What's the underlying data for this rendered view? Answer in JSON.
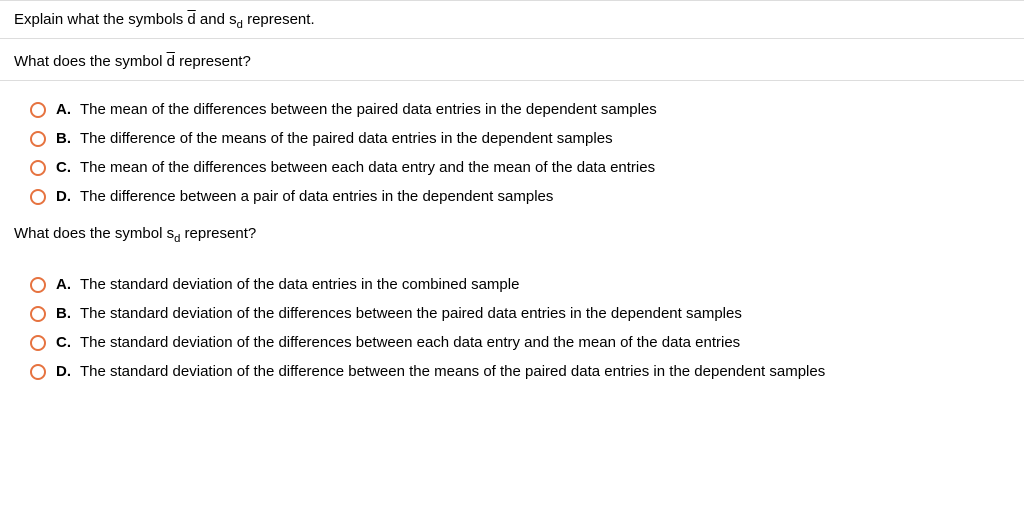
{
  "question": {
    "prompt_pre": "Explain what the symbols ",
    "sym_dbar": "d",
    "prompt_mid": " and s",
    "sym_sub": "d",
    "prompt_post": " represent."
  },
  "part1": {
    "question_pre": "What does the symbol ",
    "sym_dbar": "d",
    "question_post": " represent?",
    "options": [
      {
        "label": "A.",
        "text": "The mean of the differences between the paired data entries in the dependent samples"
      },
      {
        "label": "B.",
        "text": "The difference of the means of the paired data entries in the dependent samples"
      },
      {
        "label": "C.",
        "text": "The mean of the differences between each data entry and the mean of the data entries"
      },
      {
        "label": "D.",
        "text": "The difference between a pair of data entries in the dependent samples"
      }
    ]
  },
  "part2": {
    "question_pre": "What does the symbol s",
    "sym_sub": "d",
    "question_post": " represent?",
    "options": [
      {
        "label": "A.",
        "text": "The standard deviation of the data entries in the combined sample"
      },
      {
        "label": "B.",
        "text": "The standard deviation of the differences between the paired data entries in the dependent samples"
      },
      {
        "label": "C.",
        "text": "The standard deviation of the differences between each data entry and the mean of the data entries"
      },
      {
        "label": "D.",
        "text": "The standard deviation of the difference between the means of the paired data entries in the dependent samples"
      }
    ]
  }
}
